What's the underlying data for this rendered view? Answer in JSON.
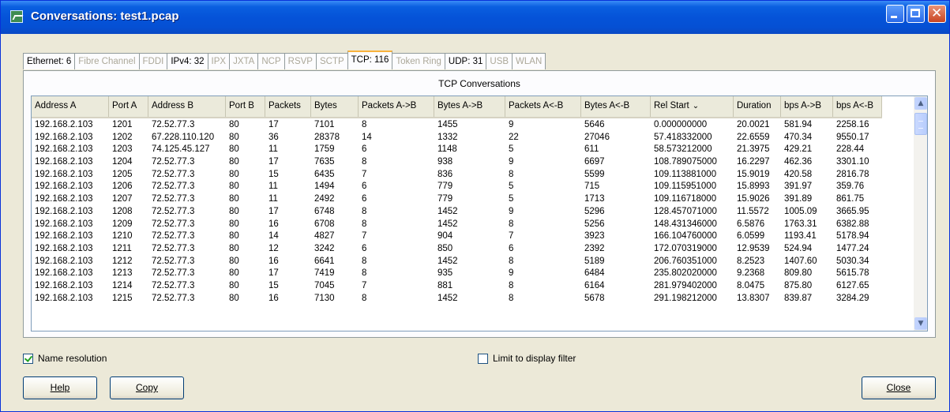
{
  "window": {
    "title": "Conversations: test1.pcap"
  },
  "tabs": [
    {
      "label": "Ethernet: 6",
      "enabled": true
    },
    {
      "label": "Fibre Channel",
      "enabled": false
    },
    {
      "label": "FDDI",
      "enabled": false
    },
    {
      "label": "IPv4: 32",
      "enabled": true
    },
    {
      "label": "IPX",
      "enabled": false
    },
    {
      "label": "JXTA",
      "enabled": false
    },
    {
      "label": "NCP",
      "enabled": false
    },
    {
      "label": "RSVP",
      "enabled": false
    },
    {
      "label": "SCTP",
      "enabled": false
    },
    {
      "label": "TCP: 116",
      "enabled": true,
      "active": true
    },
    {
      "label": "Token Ring",
      "enabled": false
    },
    {
      "label": "UDP: 31",
      "enabled": true
    },
    {
      "label": "USB",
      "enabled": false
    },
    {
      "label": "WLAN",
      "enabled": false
    }
  ],
  "panel": {
    "title": "TCP Conversations"
  },
  "table": {
    "columns": [
      "Address A",
      "Port A",
      "Address B",
      "Port B",
      "Packets",
      "Bytes",
      "Packets A->B",
      "Bytes A->B",
      "Packets A<-B",
      "Bytes A<-B",
      "Rel Start",
      "Duration",
      "bps A->B",
      "bps A<-B"
    ],
    "sort_indicator": "⌄",
    "rows": [
      [
        "192.168.2.103",
        "1201",
        "72.52.77.3",
        "80",
        "17",
        "7101",
        "8",
        "1455",
        "9",
        "5646",
        "0.000000000",
        "20.0021",
        "581.94",
        "2258.16"
      ],
      [
        "192.168.2.103",
        "1202",
        "67.228.110.120",
        "80",
        "36",
        "28378",
        "14",
        "1332",
        "22",
        "27046",
        "57.418332000",
        "22.6559",
        "470.34",
        "9550.17"
      ],
      [
        "192.168.2.103",
        "1203",
        "74.125.45.127",
        "80",
        "11",
        "1759",
        "6",
        "1148",
        "5",
        "611",
        "58.573212000",
        "21.3975",
        "429.21",
        "228.44"
      ],
      [
        "192.168.2.103",
        "1204",
        "72.52.77.3",
        "80",
        "17",
        "7635",
        "8",
        "938",
        "9",
        "6697",
        "108.789075000",
        "16.2297",
        "462.36",
        "3301.10"
      ],
      [
        "192.168.2.103",
        "1205",
        "72.52.77.3",
        "80",
        "15",
        "6435",
        "7",
        "836",
        "8",
        "5599",
        "109.113881000",
        "15.9019",
        "420.58",
        "2816.78"
      ],
      [
        "192.168.2.103",
        "1206",
        "72.52.77.3",
        "80",
        "11",
        "1494",
        "6",
        "779",
        "5",
        "715",
        "109.115951000",
        "15.8993",
        "391.97",
        "359.76"
      ],
      [
        "192.168.2.103",
        "1207",
        "72.52.77.3",
        "80",
        "11",
        "2492",
        "6",
        "779",
        "5",
        "1713",
        "109.116718000",
        "15.9026",
        "391.89",
        "861.75"
      ],
      [
        "192.168.2.103",
        "1208",
        "72.52.77.3",
        "80",
        "17",
        "6748",
        "8",
        "1452",
        "9",
        "5296",
        "128.457071000",
        "11.5572",
        "1005.09",
        "3665.95"
      ],
      [
        "192.168.2.103",
        "1209",
        "72.52.77.3",
        "80",
        "16",
        "6708",
        "8",
        "1452",
        "8",
        "5256",
        "148.431346000",
        "6.5876",
        "1763.31",
        "6382.88"
      ],
      [
        "192.168.2.103",
        "1210",
        "72.52.77.3",
        "80",
        "14",
        "4827",
        "7",
        "904",
        "7",
        "3923",
        "166.104760000",
        "6.0599",
        "1193.41",
        "5178.94"
      ],
      [
        "192.168.2.103",
        "1211",
        "72.52.77.3",
        "80",
        "12",
        "3242",
        "6",
        "850",
        "6",
        "2392",
        "172.070319000",
        "12.9539",
        "524.94",
        "1477.24"
      ],
      [
        "192.168.2.103",
        "1212",
        "72.52.77.3",
        "80",
        "16",
        "6641",
        "8",
        "1452",
        "8",
        "5189",
        "206.760351000",
        "8.2523",
        "1407.60",
        "5030.34"
      ],
      [
        "192.168.2.103",
        "1213",
        "72.52.77.3",
        "80",
        "17",
        "7419",
        "8",
        "935",
        "9",
        "6484",
        "235.802020000",
        "9.2368",
        "809.80",
        "5615.78"
      ],
      [
        "192.168.2.103",
        "1214",
        "72.52.77.3",
        "80",
        "15",
        "7045",
        "7",
        "881",
        "8",
        "6164",
        "281.979402000",
        "8.0475",
        "875.80",
        "6127.65"
      ],
      [
        "192.168.2.103",
        "1215",
        "72.52.77.3",
        "80",
        "16",
        "7130",
        "8",
        "1452",
        "8",
        "5678",
        "291.198212000",
        "13.8307",
        "839.87",
        "3284.29"
      ]
    ]
  },
  "options": {
    "name_resolution": {
      "label": "Name resolution",
      "checked": true
    },
    "limit_filter": {
      "label": "Limit to display filter",
      "checked": false
    }
  },
  "buttons": {
    "help": "Help",
    "copy": "Copy",
    "close": "Close"
  },
  "colors": {
    "titlebar": "#0553d8",
    "active_tab_accent": "#f8b23c",
    "face": "#ece9d8"
  }
}
